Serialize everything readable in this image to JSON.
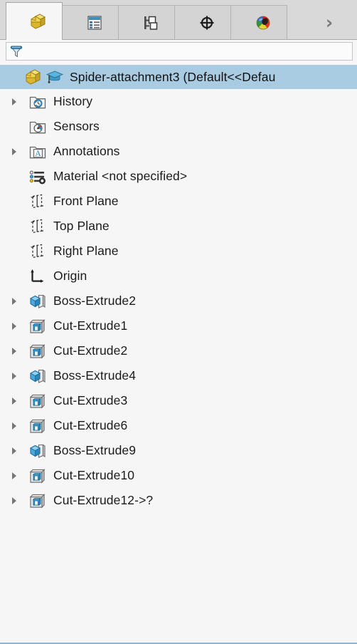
{
  "panel": {
    "name": "FeatureManager design tree panel"
  },
  "tabs": {
    "items": [
      {
        "id": "feature-manager",
        "icon": "part-yellow-icon",
        "label": "FeatureManager design tree",
        "active": true
      },
      {
        "id": "property-manager",
        "icon": "property-manager-icon",
        "label": "PropertyManager",
        "active": false
      },
      {
        "id": "configuration-manager",
        "icon": "configuration-manager-icon",
        "label": "ConfigurationManager",
        "active": false
      },
      {
        "id": "dimxpert-manager",
        "icon": "dimxpert-target-icon",
        "label": "DimXpertManager",
        "active": false
      },
      {
        "id": "display-manager",
        "icon": "display-manager-sphere-icon",
        "label": "DisplayManager",
        "active": false
      }
    ],
    "overflow_label": "›"
  },
  "filter": {
    "icon": "funnel-filter-icon",
    "value": "",
    "placeholder": ""
  },
  "tree": {
    "root": {
      "icon": "part-yellow-icon",
      "badge_icon": "graduation-cap-icon",
      "label": "Spider-attachment3  (Default<<Defau",
      "selected": true,
      "expandable": false
    },
    "items": [
      {
        "icon": "folder-history-icon",
        "label": "History",
        "expandable": true
      },
      {
        "icon": "folder-sensors-icon",
        "label": "Sensors",
        "expandable": false
      },
      {
        "icon": "folder-annotations-icon",
        "label": "Annotations",
        "expandable": true
      },
      {
        "icon": "material-icon",
        "label": "Material <not specified>",
        "expandable": false
      },
      {
        "icon": "plane-icon",
        "label": "Front Plane",
        "expandable": false
      },
      {
        "icon": "plane-icon",
        "label": "Top Plane",
        "expandable": false
      },
      {
        "icon": "plane-icon",
        "label": "Right Plane",
        "expandable": false
      },
      {
        "icon": "origin-icon",
        "label": "Origin",
        "expandable": false
      },
      {
        "icon": "boss-extrude-icon",
        "label": "Boss-Extrude2",
        "expandable": true
      },
      {
        "icon": "cut-extrude-icon",
        "label": "Cut-Extrude1",
        "expandable": true
      },
      {
        "icon": "cut-extrude-icon",
        "label": "Cut-Extrude2",
        "expandable": true
      },
      {
        "icon": "boss-extrude-icon",
        "label": "Boss-Extrude4",
        "expandable": true
      },
      {
        "icon": "cut-extrude-icon",
        "label": "Cut-Extrude3",
        "expandable": true
      },
      {
        "icon": "cut-extrude-icon",
        "label": "Cut-Extrude6",
        "expandable": true
      },
      {
        "icon": "boss-extrude-icon",
        "label": "Boss-Extrude9",
        "expandable": true
      },
      {
        "icon": "cut-extrude-icon",
        "label": "Cut-Extrude10",
        "expandable": true
      },
      {
        "icon": "cut-extrude-icon",
        "label": "Cut-Extrude12->?",
        "expandable": true
      }
    ]
  },
  "colors": {
    "selection_highlight": "#a9cce3",
    "panel_background": "#f6f6f6",
    "tabbar_background": "#d9d9d9",
    "part_yellow": "#e8c33a",
    "feature_blue": "#3f9fd0",
    "bottom_rule": "#8fb6d4"
  }
}
